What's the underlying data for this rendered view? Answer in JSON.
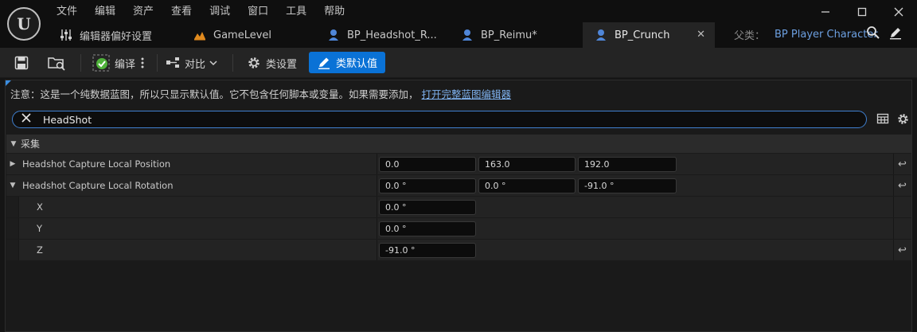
{
  "app": {
    "logo_letter": "U"
  },
  "menu": [
    "文件",
    "编辑",
    "资产",
    "查看",
    "调试",
    "窗口",
    "工具",
    "帮助"
  ],
  "tabs": [
    {
      "label": "编辑器偏好设置",
      "icon": "sliders-icon"
    },
    {
      "label": "GameLevel",
      "icon": "level-icon"
    },
    {
      "label": "BP_Headshot_R...",
      "icon": "character-icon"
    },
    {
      "label": "BP_Reimu*",
      "icon": "character-icon"
    },
    {
      "label": "BP_Crunch",
      "icon": "character-icon",
      "active": true
    }
  ],
  "parent": {
    "label": "父类：",
    "value": "BP Player Character"
  },
  "toolbar": {
    "compile_label": "编译",
    "diff_label": "对比",
    "class_settings_label": "类设置",
    "class_defaults_label": "类默认值"
  },
  "notice": {
    "text": "注意：这是一个纯数据蓝图，所以只显示默认值。它不包含任何脚本或变量。如果需要添加，",
    "link": "打开完整蓝图编辑器"
  },
  "search": {
    "value": "HeadShot"
  },
  "details": {
    "category": "采集",
    "rows": [
      {
        "name": "Headshot Capture Local Position",
        "values": [
          "0.0",
          "163.0",
          "192.0"
        ]
      },
      {
        "name": "Headshot Capture Local Rotation",
        "values": [
          "0.0 °",
          "0.0 °",
          "-91.0 °"
        ]
      }
    ],
    "children": [
      {
        "name": "X",
        "value": "0.0 °"
      },
      {
        "name": "Y",
        "value": "0.0 °"
      },
      {
        "name": "Z",
        "value": "-91.0 °"
      }
    ]
  },
  "colors": {
    "accent": "#0a72d6",
    "link": "#7fb2ef",
    "parent": "#6c9fe0"
  }
}
